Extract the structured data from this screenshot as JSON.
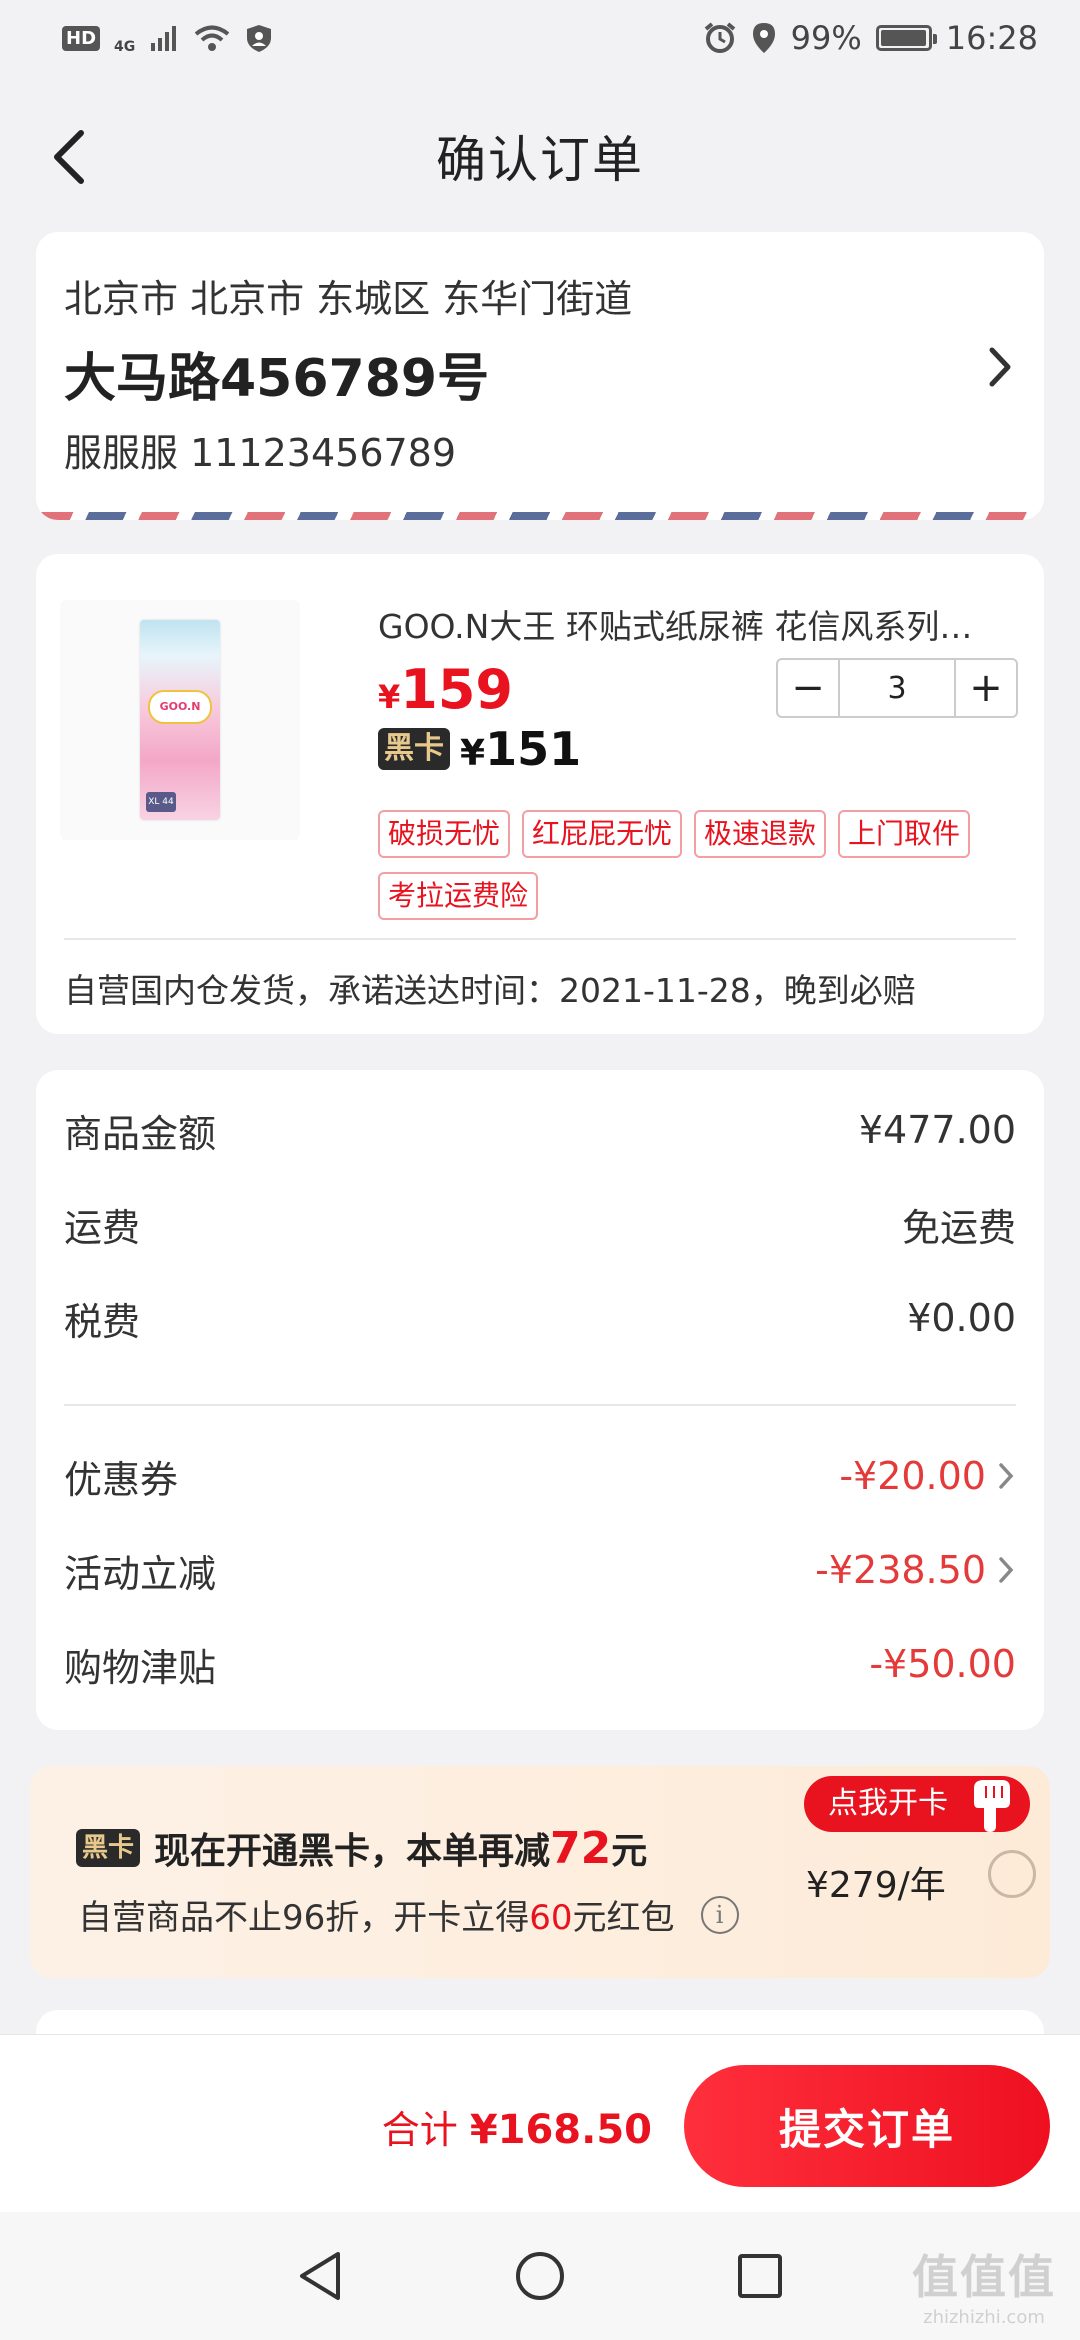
{
  "status_bar": {
    "hd": "HD",
    "network": "4G",
    "battery_text": "99%",
    "battery_level": 0.99,
    "time": "16:28"
  },
  "header": {
    "title": "确认订单"
  },
  "address": {
    "region": "北京市 北京市 东城区 东华门街道",
    "street": "大马路456789号",
    "recipient": "服服服 11123456789"
  },
  "product": {
    "title": "GOO.N大王 环贴式纸尿裤 花信风系列…",
    "price_symbol": "¥",
    "price": "159",
    "vip_tag": "黑卡",
    "vip_price_symbol": "¥",
    "vip_price": "151",
    "quantity": "3",
    "minus_label": "−",
    "plus_label": "+",
    "services": [
      "破损无忧",
      "红屁屁无忧",
      "极速退款",
      "上门取件",
      "考拉运费险"
    ],
    "shipping_note": "自营国内仓发货，承诺送达时间：2021-11-28，晚到必赔",
    "image_logo_text": "GOO.N",
    "image_size_text": "XL 44"
  },
  "summary": {
    "rows": [
      {
        "label": "商品金额",
        "value": "¥477.00"
      },
      {
        "label": "运费",
        "value": "免运费"
      },
      {
        "label": "税费",
        "value": "¥0.00"
      }
    ],
    "discounts": [
      {
        "label": "优惠券",
        "value": "-¥20.00"
      },
      {
        "label": "活动立减",
        "value": "-¥238.50"
      },
      {
        "label": "购物津贴",
        "value": "-¥50.00"
      }
    ]
  },
  "black_card": {
    "tag": "黑卡",
    "line1_prefix": "现在开通黑卡，本单再减",
    "line1_amount": "72",
    "line1_suffix": "元",
    "line2_prefix": "自营商品不止96折，开卡立得",
    "line2_amount": "60",
    "line2_suffix": "元红包",
    "info_symbol": "i",
    "bubble": "点我开卡",
    "price": "¥279/年"
  },
  "bottom": {
    "total_label": "合计",
    "total_value": "¥168.50",
    "submit_label": "提交订单"
  },
  "watermark": {
    "main": "值值值",
    "sub": "zhizhizhi.com"
  },
  "colors": {
    "accent_red": "#e8131f",
    "discount_red": "#e43a3a",
    "page_bg": "#f2f2f4",
    "vip_gold": "#e8c98d"
  }
}
